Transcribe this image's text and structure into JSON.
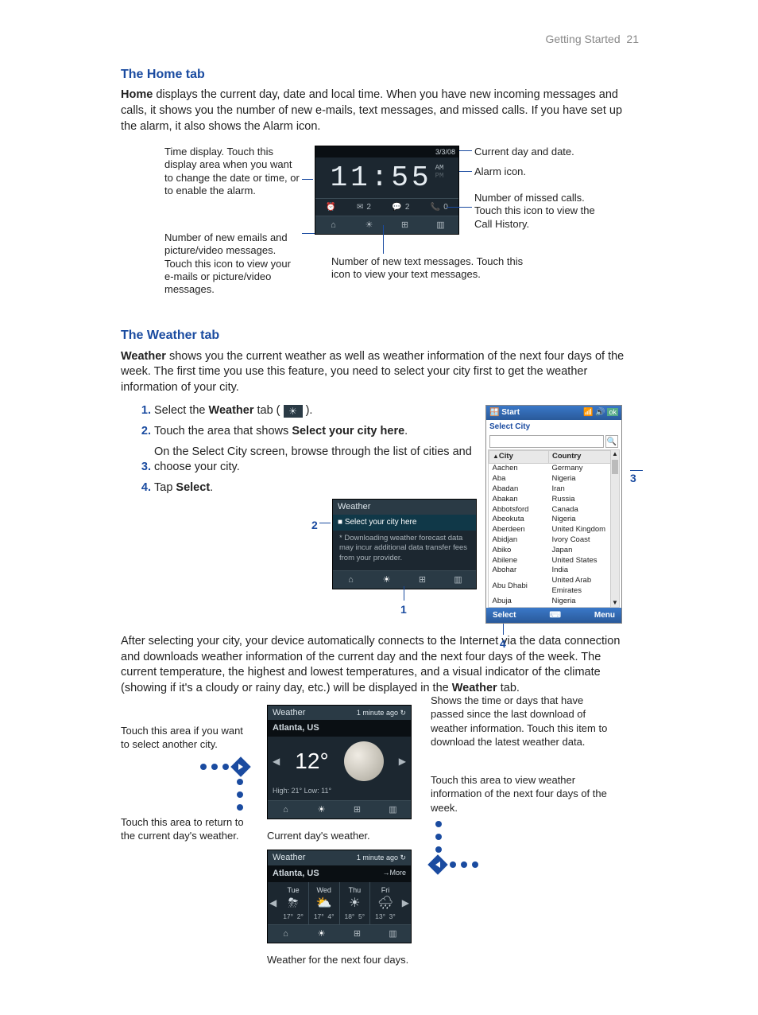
{
  "header": {
    "section": "Getting Started",
    "page_number": "21"
  },
  "home_tab": {
    "heading": "The Home tab",
    "intro_prefix": "Home",
    "intro_rest": " displays the current day, date and local time. When you have new incoming messages and calls, it shows you the number of new e-mails, text messages, and missed calls. If you have set up the alarm, it also shows the Alarm icon.",
    "ann_time": "Time display. Touch this display area when you want to change the date or time, or to enable the alarm.",
    "ann_email": "Number of new emails and picture/video messages. Touch this icon to view your e-mails or picture/video messages.",
    "ann_sms": "Number of new text messages. Touch this icon to view your text messages.",
    "ann_date": "Current day and date.",
    "ann_alarm": "Alarm icon.",
    "ann_calls": "Number of missed calls. Touch this icon to view the Call History.",
    "screen": {
      "date": "3/3/08",
      "time": "11:55",
      "am": "AM",
      "pm": "PM",
      "alarm_glyph": "⏰",
      "email_glyph": "✉",
      "email_count": "2",
      "sms_glyph": "💬",
      "sms_count": "2",
      "call_glyph": "📞",
      "call_count": "0",
      "footer_home": "⌂",
      "footer_weather": "☀",
      "footer_apps": "⊞",
      "footer_media": "▥"
    }
  },
  "weather_tab": {
    "heading": "The Weather tab",
    "intro_prefix": "Weather",
    "intro_rest": " shows you the current weather as well as weather information of the next four days of the week. The first time you use this feature, you need to select your city first to get the weather information of your city.",
    "step1_pre": "Select the ",
    "step1_bold": "Weather",
    "step1_post": " tab ( ",
    "step1_icon": "☀",
    "step1_close": " ).",
    "step2_pre": "Touch the area that shows ",
    "step2_bold": "Select your city here",
    "step2_post": ".",
    "step3": "On the Select City screen, browse through the list of cities and choose your city.",
    "step4_pre": "Tap ",
    "step4_bold": "Select",
    "step4_post": ".",
    "select_screen": {
      "title": "Weather",
      "prompt": "Select your city here",
      "note": "* Downloading weather forecast data may incur additional data transfer fees from your provider."
    },
    "city_screen": {
      "start": "Start",
      "ok": "ok",
      "subtitle": "Select City",
      "col_city": "City",
      "col_country": "Country",
      "select": "Select",
      "menu": "Menu",
      "rows": [
        {
          "city": "Aachen",
          "country": "Germany"
        },
        {
          "city": "Aba",
          "country": "Nigeria"
        },
        {
          "city": "Abadan",
          "country": "Iran"
        },
        {
          "city": "Abakan",
          "country": "Russia"
        },
        {
          "city": "Abbotsford",
          "country": "Canada"
        },
        {
          "city": "Abeokuta",
          "country": "Nigeria"
        },
        {
          "city": "Aberdeen",
          "country": "United Kingdom"
        },
        {
          "city": "Abidjan",
          "country": "Ivory Coast"
        },
        {
          "city": "Abiko",
          "country": "Japan"
        },
        {
          "city": "Abilene",
          "country": "United States"
        },
        {
          "city": "Abohar",
          "country": "India"
        },
        {
          "city": "Abu Dhabi",
          "country": "United Arab Emirates"
        },
        {
          "city": "Abuja",
          "country": "Nigeria"
        }
      ]
    },
    "callouts": {
      "c1": "1",
      "c2": "2",
      "c3": "3",
      "c4": "4"
    },
    "after_para_pre": "After selecting your city, your device automatically connects to the Internet via the data connection and downloads weather information of the current day and the next four days of the week. The current temperature, the highest and lowest temperatures, and a visual indicator of the climate (showing if it's a cloudy or rainy day, etc.) will be displayed in the ",
    "after_para_bold": "Weather",
    "after_para_post": " tab.",
    "ann_left_city": "Touch this area if you want to select another city.",
    "ann_left_return": "Touch this area to return to the current day's weather.",
    "ann_right_time": "Shows the time or days that have passed since the last download of weather information. Touch this item to download the latest weather data.",
    "ann_right_forecast": "Touch this area to view weather information of the next four days of the week.",
    "cap_current": "Current day's weather.",
    "cap_forecast": "Weather for the next four days.",
    "current_screen": {
      "title": "Weather",
      "updated": "1 minute ago ↻",
      "city": "Atlanta, US",
      "temp": "12°",
      "hi_lo": "High: 21°   Low: 11°"
    },
    "forecast_screen": {
      "title": "Weather",
      "updated": "1 minute ago ↻",
      "city": "Atlanta, US",
      "more": "→More",
      "days": [
        {
          "name": "Tue",
          "icon": "⛈",
          "hi": "17°",
          "lo": "2°"
        },
        {
          "name": "Wed",
          "icon": "⛅",
          "hi": "17°",
          "lo": "4°"
        },
        {
          "name": "Thu",
          "icon": "☀",
          "hi": "18°",
          "lo": "5°"
        },
        {
          "name": "Fri",
          "icon": "🌧",
          "hi": "13°",
          "lo": "3°"
        }
      ]
    }
  }
}
